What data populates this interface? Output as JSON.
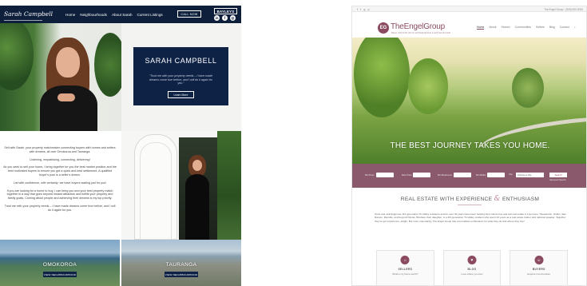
{
  "left_site": {
    "logo": "Sarah Campbell",
    "nav": [
      "Home",
      "Neighbourhoods",
      "About Sarah",
      "Current Listings"
    ],
    "call_button": "CALL NOW",
    "brand": "BAYLEYS",
    "social_icons": [
      "linkedin-icon",
      "facebook-icon",
      "instagram-icon"
    ],
    "hero": {
      "name": "SARAH CAMPBELL",
      "quote": "\"Trust me with your property needs – I have made dreams come true before, and I will do it again for you.\"",
      "button": "Learn More"
    },
    "about_paragraphs": [
      "Sell with Sarah, your property matchmaker connecting buyers with homes and sellers with dreams, all over Omokoroa and Tauranga.",
      "Listening, empathising, connecting, delivering!",
      "As you seek to sell your home, I bring together for you the best market position and the best motivated buyers to ensure you get a quick and best settlement. A qualified buyer's pool is a seller's dream.",
      "List with confidence, with certainty: we have buyers waiting just for you!",
      "If you are looking for a home to buy, I can bring you and your best property match together in a way that goes beyond instant attraction and fulfills your property and family goals. Coming about people and achieving their dreams is my top priority.",
      "Trust me with your property needs – I have made dreams come true before, and I will do it again for you."
    ],
    "neighbourhoods": [
      {
        "name": "OMOKOROA",
        "button": "VIEW NEIGHBOURHOOD"
      },
      {
        "name": "TAURANGA",
        "button": "VIEW NEIGHBOURHOOD"
      }
    ]
  },
  "right_site": {
    "topbar": {
      "social": [
        "f",
        "t",
        "g",
        "p"
      ],
      "contact": "The Engel Group · (925) 000-0000"
    },
    "logo": "TheEngelGroup",
    "logo_mark": "EG",
    "tagline": "REAL ESTATE WITH EXPERIENCE & ENTHUSIASM",
    "nav": [
      "Home",
      "About",
      "Search",
      "Communities",
      "Sellers",
      "Blog",
      "Contact"
    ],
    "search_icon": "search-icon",
    "headline": "THE BEST JOURNEY TAKES YOU HOME.",
    "search": {
      "fields": [
        "Min Price",
        "Max Price",
        "Min Bedrooms",
        "Min Baths",
        "City"
      ],
      "city_value": "Choose a City",
      "go": "Search",
      "advanced": "Advanced Search"
    },
    "section_title_a": "REAL ESTATE WITH EXPERIENCE",
    "section_title_amp": "&",
    "section_title_b": "ENTHUSIASM",
    "intro": "Chris and Jodi Engel are 3rd generation Tri-Valley residents and for over 30 years have been helping their clients buy and sell real estate in Livermore, Pleasanton, Dublin, San Ramon, Danville, and beyond! Nicole Hinshaw, their daughter, is a 4th generation Tri-Valley resident who spent 10 years as a real estate trainer and national speaker. Together, they've got experience, alright. But more importantly, The Engel Group has a boundless enthusiasm for what they do and where they live!",
    "cards": [
      {
        "icon": "house-icon",
        "title": "SELLERS",
        "subtitle": "What's my home worth?"
      },
      {
        "icon": "heart-icon",
        "title": "BLOG",
        "subtitle": "Love where you live!"
      },
      {
        "icon": "people-icon",
        "title": "BUYERS",
        "subtitle": "Explore Communities"
      }
    ]
  }
}
